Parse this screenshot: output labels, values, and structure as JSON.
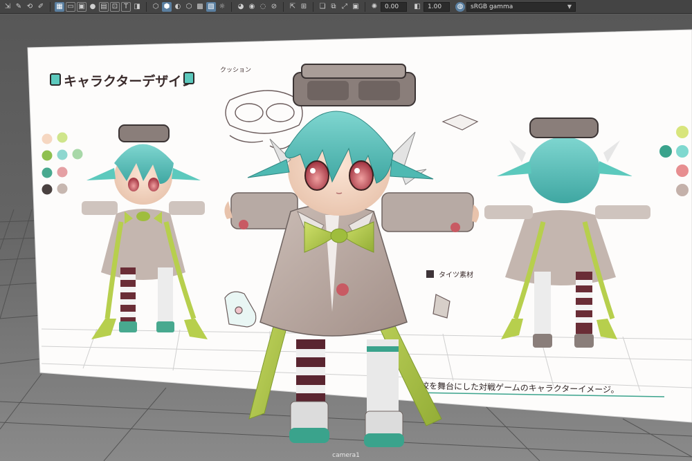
{
  "toolbar": {
    "exposure_value": "0.00",
    "gamma_value": "1.00",
    "color_space": "sRGB gamma",
    "dropdown_glyph": "▼"
  },
  "viewport": {
    "camera_label": "camera1",
    "board": {
      "title": "キャラクターデザイン",
      "note_cushion": "クッション",
      "note_tights": "タイツ素材",
      "caption": "学校を舞台にした対戦ゲームのキャラクターイメージ。"
    }
  },
  "colors": {
    "toolbar_bg": "#444444",
    "accent": "#5a7fa0",
    "hair": "#62c4bf",
    "coat": "#b9aaa3",
    "ribbon": "#b7cf4d",
    "stripe_dark": "#5a2530",
    "board_paper": "#fdfcfb"
  },
  "swatches_left": [
    "#f6d7c1",
    "#cfe58b",
    "#8fc04f",
    "#8ed7cf",
    "#a8d8a8",
    "#48a98f",
    "#e5a0a4",
    "#4a4140",
    "#c7b7b0"
  ],
  "swatches_right": [
    "#d8e57c",
    "#3aa38c",
    "#7fd8cf",
    "#e78e90",
    "#c4b1aa"
  ]
}
